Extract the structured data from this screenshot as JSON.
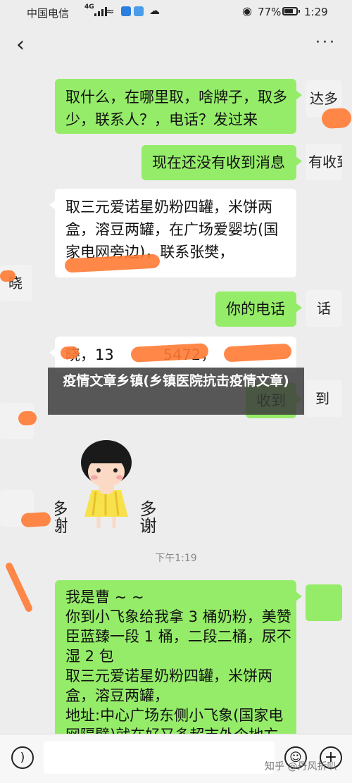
{
  "status_bar": {
    "carrier": "中国电信",
    "network": "4G",
    "battery_pct": "77%",
    "battery_level": 0.77,
    "time": "1:29"
  },
  "nav": {
    "back_icon": "chevron-left-icon",
    "more_icon": "more-dots-icon"
  },
  "messages": [
    {
      "from": "me",
      "lines": [
        "取什么，在哪里取，啥牌子，取多",
        "少，联系人？，电话？发过来"
      ],
      "avatar": "达多"
    },
    {
      "from": "me",
      "lines": [
        "现在还没有收到消息"
      ],
      "avatar": "有收到"
    },
    {
      "from": "them",
      "lines": [
        "取三元爱诺星奶粉四罐，米饼两",
        "盒，溶豆两罐，在广场爱婴坊(国",
        "家电网旁边)，联系张樊，"
      ],
      "avatar": "晓"
    },
    {
      "from": "me",
      "lines": [
        "你的电话"
      ],
      "avatar": "话"
    },
    {
      "from": "them",
      "lines": [
        "晓，13",
        "5472，"
      ],
      "avatar": ""
    },
    {
      "from": "me",
      "lines": [
        "收到"
      ],
      "avatar": "到"
    },
    {
      "from": "me",
      "lines": [
        "我是曹 ~ ~",
        "你到小飞象给我拿 3 桶奶粉，美赞",
        "臣蓝臻一段 1 桶，二段二桶，尿不",
        "湿 2 包",
        "取三元爱诺星奶粉四罐，米饼两",
        "盒，溶豆两罐，",
        "地址:中心广场东侧小飞象(国家电",
        "网隔壁)就在好又多超市外个地方"
      ],
      "avatar": ""
    }
  ],
  "sticker": {
    "left_text": "多谢",
    "right_text": "多谢"
  },
  "time_label": "下午1:19",
  "caption": "疫情文章乡镇(乡镇医院抗击疫情文章)",
  "input_bar": {
    "voice_icon": "voice-icon",
    "emoji_icon": "emoji-icon",
    "plus_icon": "plus-icon"
  },
  "watermark": "知乎 @丹风折叭"
}
